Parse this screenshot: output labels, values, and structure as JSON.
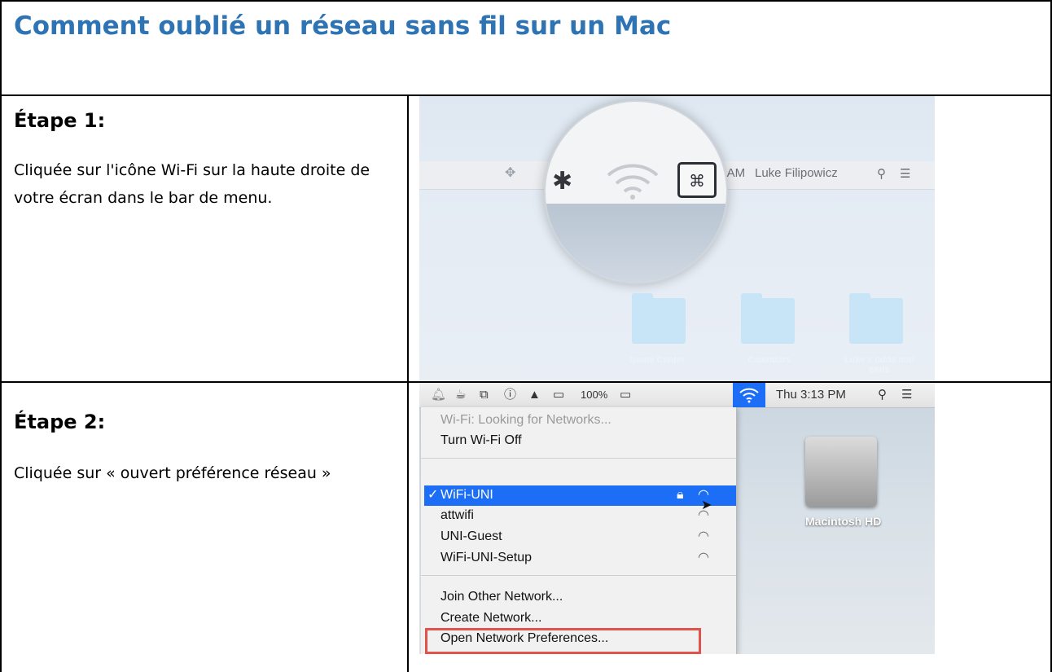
{
  "title": "Comment oublié un réseau sans fil sur un Mac",
  "steps": [
    {
      "heading": "Étape 1:",
      "text": "Cliquée sur l'icône Wi-Fi sur la haute droite de votre écran dans le bar de menu."
    },
    {
      "heading": "Étape 2:",
      "text": "Cliquée sur « ouvert préférence réseau »"
    }
  ],
  "screenshot1": {
    "menubar_time": "1 AM",
    "menubar_user": "Luke Filipowicz",
    "menubar_search_icon": "search-icon",
    "menubar_list_icon": "list-icon",
    "magnifier_icons": [
      "bluetooth-icon",
      "wifi-icon",
      "command-key-icon"
    ],
    "command_key_glyph": "⌘",
    "folders": [
      {
        "label": "Game Center"
      },
      {
        "label": "Calendars"
      },
      {
        "label": "Luke's odds and ends"
      }
    ]
  },
  "screenshot2": {
    "battery": "100%",
    "clock": "Thu 3:13 PM",
    "menu_items": {
      "status": "Wi-Fi: Looking for Networks...",
      "turn_off": "Turn Wi-Fi Off",
      "networks": [
        {
          "name": "WiFi-UNI",
          "selected": true,
          "locked": true
        },
        {
          "name": "attwifi",
          "selected": false,
          "locked": false
        },
        {
          "name": "UNI-Guest",
          "selected": false,
          "locked": false
        },
        {
          "name": "WiFi-UNI-Setup",
          "selected": false,
          "locked": false
        }
      ],
      "join_other": "Join Other Network...",
      "create": "Create Network...",
      "open_prefs": "Open Network Preferences..."
    },
    "checkmark": "✓",
    "desktop_drive_label": "Macintosh HD",
    "highlight_color": "#e0524a"
  },
  "colors": {
    "title": "#2e74b5",
    "mac_selection": "#1b6ef5"
  }
}
